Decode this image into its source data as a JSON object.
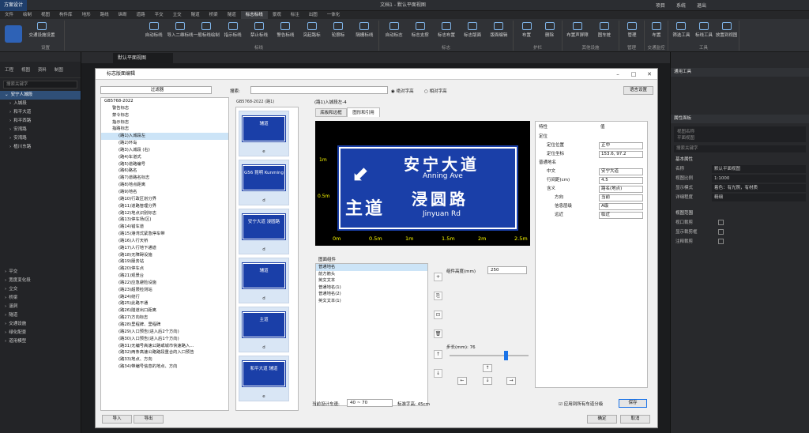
{
  "app": {
    "title": "文档1 - 默认平面视图",
    "tab_main": "方案设计",
    "ribbon_tabs": [
      "文件",
      "绘制",
      "视图",
      "构件库",
      "地形",
      "路线",
      "纵断",
      "道路",
      "平交",
      "立交",
      "隧道",
      "桥梁",
      "隧道",
      "标志标线",
      "景观",
      "标注",
      "出图",
      "一体化"
    ],
    "top_right": [
      "项目",
      "系统",
      "退出"
    ]
  },
  "ribbon": {
    "groups": [
      {
        "title": "设置",
        "buttons": [
          "交通设施设置"
        ]
      },
      {
        "title": "标线",
        "buttons": [
          "自动标线",
          "导入二维标线",
          "一般标线绘制",
          "指示标线",
          "禁止标线",
          "警告标线",
          "突起路标",
          "轮廓标",
          "隔栅标线"
        ]
      },
      {
        "title": "标志",
        "buttons": [
          "自动标志",
          "标志支撑",
          "标志布置",
          "标志版面",
          "版面编辑"
        ]
      },
      {
        "title": "护栏",
        "buttons": [
          "布置",
          "删除"
        ]
      },
      {
        "title": "其他设施",
        "buttons": [
          "布置声屏障",
          "图车桩"
        ]
      },
      {
        "title": "管理",
        "buttons": [
          "管理"
        ]
      },
      {
        "title": "交通监控",
        "buttons": [
          "布置"
        ]
      },
      {
        "title": "工具",
        "buttons": [
          "筛选工具",
          "标线工具",
          "放置到视图"
        ]
      }
    ]
  },
  "left_panel": {
    "tabs": [
      "工程",
      "视图",
      "资料",
      "制图"
    ],
    "search_placeholder": "搜索关键字",
    "items": [
      "安宁人城段",
      "入城段",
      "和平大道",
      "和平西路",
      "安湾路",
      "安湾路",
      "植川东路"
    ],
    "lower_items": [
      "平交",
      "宽度变化段",
      "立交",
      "桥梁",
      "涵洞",
      "隧道",
      "交通设施",
      "绿化配景",
      "道用模型"
    ]
  },
  "canvas_tab": "默认平面视图",
  "right_panel": {
    "title": "通用工具",
    "props_title": "属性面板",
    "view_name_label": "视图名称",
    "view_name_value": "平面视图",
    "search_placeholder": "搜索关键字",
    "basic_title": "基本属性",
    "rows": [
      {
        "k": "名称",
        "v": "默认平面视图"
      },
      {
        "k": "视图比例",
        "v": "1:1000"
      },
      {
        "k": "显示模式",
        "v": "着色：有光照，有材质"
      },
      {
        "k": "详细程度",
        "v": "精细"
      }
    ],
    "range_title": "视图范围",
    "checks": [
      "视口裁剪",
      "显示裁剪框",
      "注释裁剪"
    ]
  },
  "dialog": {
    "title": "标志版面编辑",
    "filter_label": "过滤器",
    "search_label": "搜索:",
    "radio1": "绝对字高",
    "radio2": "相对字高",
    "lang_button": "语言设置",
    "code_label": "GB5768-2022 (路1)",
    "selected_path": "(路1)入城段左-4",
    "tab1": "底板和边框",
    "tab2": "图形和引用",
    "tree_root": "GB5768-2022",
    "tree_cats": [
      "警告标志",
      "禁令标志",
      "指示标志",
      "指路标志"
    ],
    "tree_items": [
      "(路1)入城段左",
      "(路2)环岛",
      "(路3)入城段 (右)",
      "(路4)车道式",
      "(路5)道路编号",
      "(路6)路名",
      "(路7)道路名标志",
      "(路8)地点距离",
      "(路9)地名",
      "(路10)行政区划分界",
      "(路11)道路管理分界",
      "(路12)地点识别标志",
      "(路13)停车场(区)",
      "(路14)错车道",
      "(路15)港湾式紧急停车带",
      "(路16)人行天桥",
      "(路17)人行地下通道",
      "(路18)无障碍设施",
      "(路19)服务站",
      "(路20)停车点",
      "(路21)观景台",
      "(路22)应急避险设施",
      "(路23)超限检测站",
      "(路24)绕行",
      "(路25)此路不通",
      "(路26)隧道出口距离",
      "(路27)方向标志",
      "(路28)里程牌、里程碑",
      "(路29)入口预告(进入后2个方向)",
      "(路30)入口预告(进入后1个方向)",
      "(路31)无编号高速公路或城市快速路入...",
      "(路32)两条高速公路路段重合的入口预告",
      "(路33)地点、方向",
      "(路34)带编号信息的地点、方向"
    ],
    "thumbs": [
      {
        "text": "辅道",
        "label": "e"
      },
      {
        "text": "G56 昆明 Kunming",
        "label": "d"
      },
      {
        "text": "安宁大道 浸圆路",
        "label": "d"
      },
      {
        "text": "辅道",
        "label": "d"
      },
      {
        "text": "主道",
        "label": "d"
      },
      {
        "text": "和平大道 辅道",
        "label": "e"
      }
    ],
    "sign": {
      "line1": "安宁大道",
      "line1_en": "Anning Ave",
      "main": "主道",
      "line2": "浸圆路",
      "line2_en": "Jinyuan Rd",
      "ruler": [
        "0m",
        "0.5m",
        "1m",
        "1.5m",
        "2m",
        "2.5m"
      ],
      "vruler": [
        "1m",
        "0.5m"
      ]
    },
    "props_header": [
      "特性",
      "值"
    ],
    "props": [
      {
        "k": "定位",
        "v": ""
      },
      {
        "k": "定位位置",
        "v": "正中"
      },
      {
        "k": "定位坐标",
        "v": "153.6, 97.2"
      },
      {
        "k": "普通地名",
        "v": ""
      },
      {
        "k": "中文",
        "v": "安宁大道"
      },
      {
        "k": "行间距(cm)",
        "v": "4.5"
      },
      {
        "k": "含义",
        "v": "路名(地点)"
      },
      {
        "k": "方向",
        "v": "当前"
      },
      {
        "k": "信息层级",
        "v": "A级"
      },
      {
        "k": "远近",
        "v": "临近"
      }
    ],
    "comp_title": "图面组件",
    "comps": [
      "普通地名",
      "前方箭头",
      "英文文本",
      "普通地名(1)",
      "普通地名(2)",
      "英文文本(1)"
    ],
    "comp_height_label": "组件高度(mm)",
    "comp_height_value": "250",
    "step_label": "步长(mm): 76",
    "speed_label": "当前设计车速:",
    "speed_value": "40 ~ 70",
    "font_label": "标准字高: 45cm",
    "apply_label": "应用到所有车道分级",
    "save": "保存",
    "import": "导入",
    "export": "导出",
    "ok": "确定",
    "cancel": "取消"
  }
}
